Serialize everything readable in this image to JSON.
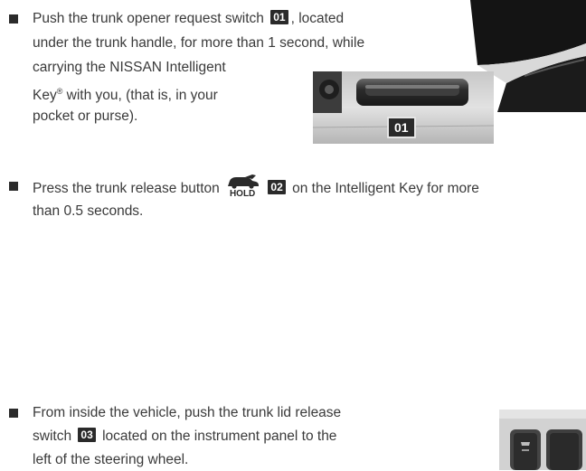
{
  "section1": {
    "line1_a": "Push the trunk opener request switch",
    "badge": "01",
    "line1_b": ", located",
    "line2": "under the trunk handle, for more than 1 second, while",
    "line3": "carrying the NISSAN Intelligent",
    "line4_a": "Key",
    "reg": "®",
    "line4_b": " with you, (that is, in your",
    "line5": "pocket or purse).",
    "photo_badge": "01"
  },
  "section2": {
    "line1_a": "Press the trunk release button",
    "hold_label": "HOLD",
    "badge": "02",
    "line1_b": "on the Intelligent Key for more",
    "line2": "than 0.5 seconds."
  },
  "section3": {
    "line1": "From inside the vehicle, push the trunk lid release",
    "line2_a": "switch",
    "badge": "03",
    "line2_b": "located on the instrument panel to the",
    "line3": "left of the steering wheel."
  },
  "colors": {
    "text": "#3a3a3a",
    "badge_bg": "#2a2a2a",
    "bullet": "#2b2b2b"
  }
}
